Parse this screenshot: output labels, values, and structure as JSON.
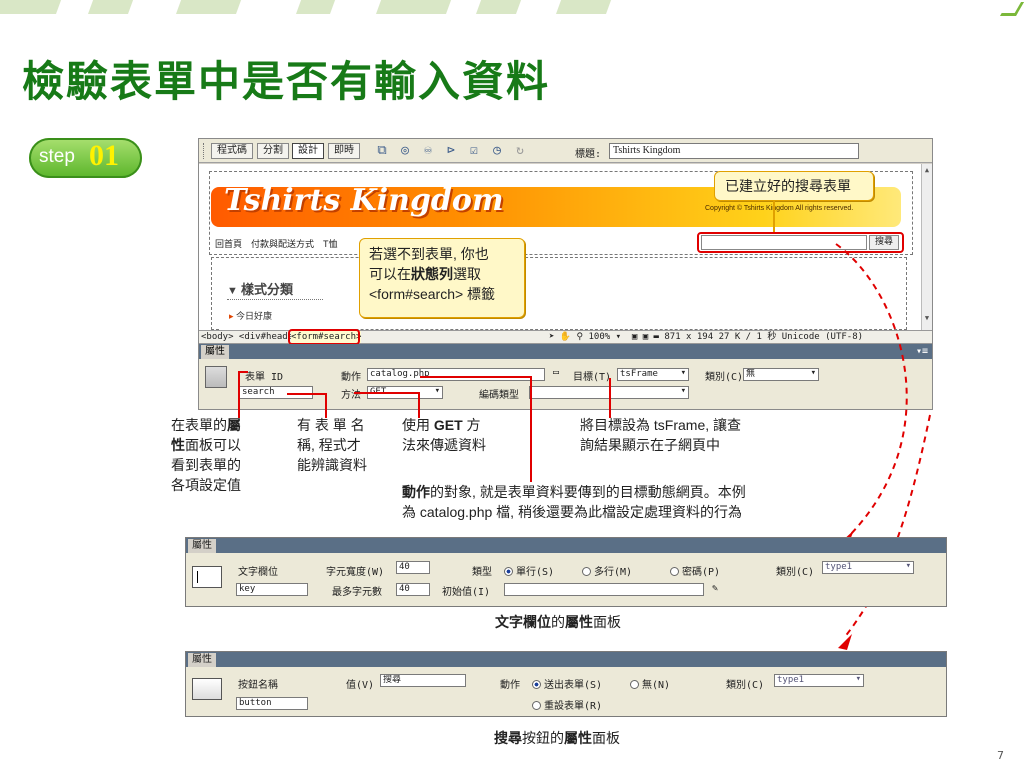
{
  "slide": {
    "title": "檢驗表單中是否有輸入資料",
    "step_word": "step",
    "step_number": "01",
    "page_number": "7",
    "accent_color": "#177a17"
  },
  "toolbar": {
    "buttons": [
      "程式碼",
      "分割",
      "設計",
      "即時"
    ],
    "title_label": "標題:",
    "title_value": "Tshirts Kingdom"
  },
  "site": {
    "brand": "Tshirts Kingdom",
    "copyright": "Copyright © Tshirts Kingdom All rights reserved.",
    "nav": "回首頁　付款與配送方式　T恤",
    "search_button": "搜尋",
    "side_title": "樣式分類",
    "side_item": "今日好康"
  },
  "statusbar": {
    "tags": "<body> <div#header>",
    "selected_tag": "<form#search>",
    "zoom": "100%",
    "size": "871 x 194",
    "info": "27 K / 1 秒  Unicode (UTF-8)"
  },
  "form_panel": {
    "tab": "屬性",
    "form_id_label": "表單 ID",
    "form_id_value": "search",
    "action_label": "動作",
    "action_value": "catalog.php",
    "target_label": "目標(T)",
    "target_value": "tsFrame",
    "class_label": "類別(C)",
    "class_value": "無",
    "method_label": "方法",
    "method_value": "GET",
    "enctype_label": "編碼類型"
  },
  "callouts": {
    "top_right": "已建立好的搜尋表單",
    "middle_line1": "若選不到表單, 你也",
    "middle_line2_pre": "可以在",
    "middle_line2_bold": "狀態列",
    "middle_line2_post": "選取",
    "middle_line3": "<form#search> 標籤"
  },
  "notes": {
    "n1_pre": "在表單的",
    "n1_bold": "屬",
    "n1_line2_bold": "性",
    "n1_line2": "面板可以",
    "n1_line3": "看到表單的",
    "n1_line4": "各項設定值",
    "n2_line1": "有 表 單 名",
    "n2_line2": "稱, 程式才",
    "n2_line3": "能辨識資料",
    "n3_line1_pre": "使用 ",
    "n3_line1_bold": "GET",
    "n3_line1_post": " 方",
    "n3_line2": "法來傳遞資料",
    "n4_line1": "將目標設為 tsFrame, 讓查",
    "n4_line2": "詢結果顯示在子網頁中",
    "n5_bold": "動作",
    "n5_line1": "的對象, 就是表單資料要傳到的目標動態網頁。本例",
    "n5_line2": "為 catalog.php 檔, 稍後還要為此檔設定處理資料的行為"
  },
  "text_panel": {
    "tab": "屬性",
    "field_label": "文字欄位",
    "field_name": "key",
    "char_width_label": "字元寬度(W)",
    "char_width": "40",
    "max_chars_label": "最多字元數",
    "max_chars": "40",
    "type_label": "類型",
    "type_options": [
      "單行(S)",
      "多行(M)",
      "密碼(P)"
    ],
    "init_label": "初始值(I)",
    "class_label": "類別(C)",
    "class_value": "type1",
    "caption_bold1": "文字欄位",
    "caption_mid": "的",
    "caption_bold2": "屬性",
    "caption_end": "面板"
  },
  "button_panel": {
    "tab": "屬性",
    "name_label": "按鈕名稱",
    "name_value": "button",
    "value_label": "值(V)",
    "value_value": "搜尋",
    "action_label": "動作",
    "action_options": [
      "送出表單(S)",
      "無(N)",
      "重設表單(R)"
    ],
    "class_label": "類別(C)",
    "class_value": "type1",
    "caption_bold1": "搜尋",
    "caption_mid": "按鈕的",
    "caption_bold2": "屬性",
    "caption_end": "面板"
  }
}
